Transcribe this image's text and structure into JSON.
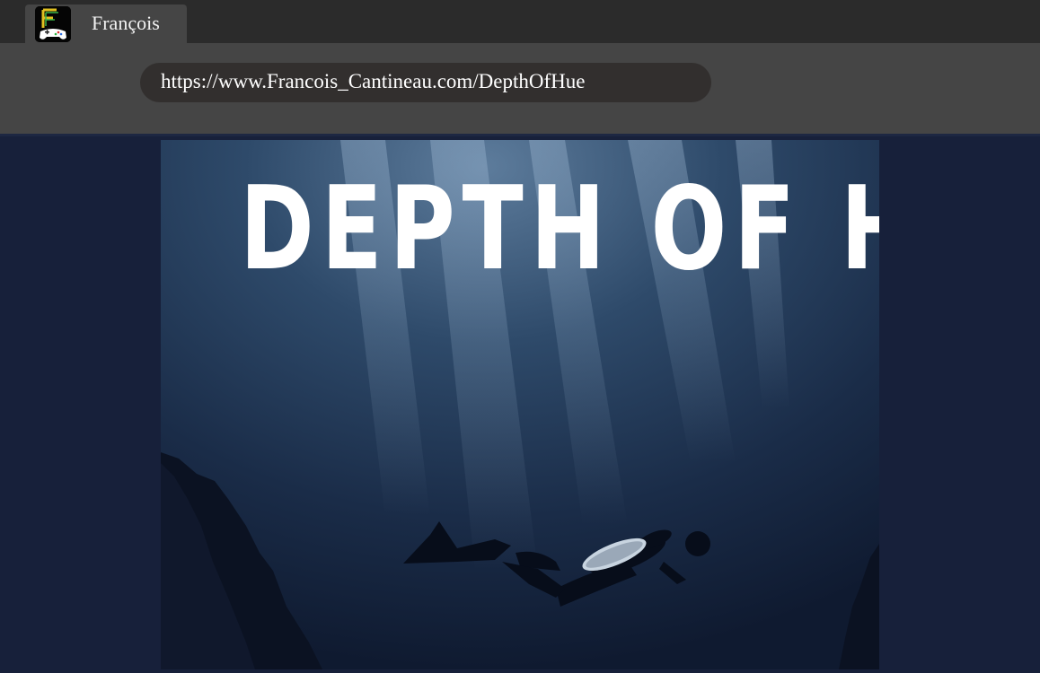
{
  "browser": {
    "tab": {
      "title": "François",
      "icon": "game-controller-f-icon"
    },
    "address_bar": {
      "url": "https://www.Francois_Cantineau.com/DepthOfHue"
    }
  },
  "page": {
    "hero": {
      "title": "DEPTH OF HUE",
      "image": "scuba-diver-underwater-cave"
    }
  },
  "colors": {
    "tabbar_bg": "#2b2b2b",
    "toolbar_bg": "#454545",
    "urlbar_bg": "#322f2e",
    "page_bg": "#17203a",
    "hero_title": "#ffffff"
  }
}
